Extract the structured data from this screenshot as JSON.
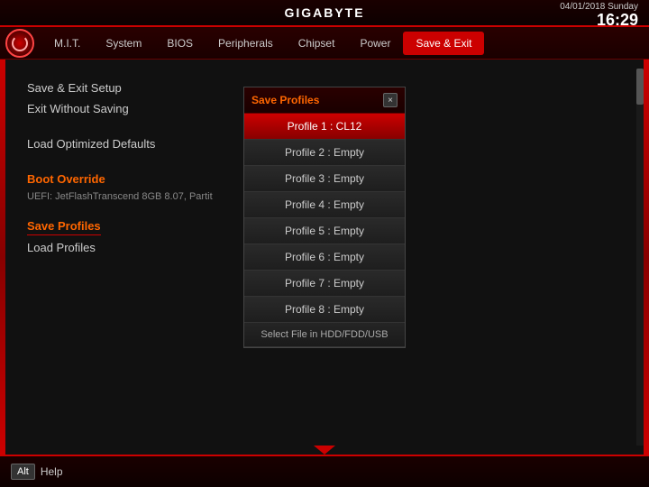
{
  "header": {
    "title": "GIGABYTE",
    "date": "04/01/2018",
    "day": "Sunday",
    "time": "16:29"
  },
  "navbar": {
    "items": [
      {
        "label": "M.I.T.",
        "active": false
      },
      {
        "label": "System",
        "active": false
      },
      {
        "label": "BIOS",
        "active": false
      },
      {
        "label": "Peripherals",
        "active": false
      },
      {
        "label": "Chipset",
        "active": false
      },
      {
        "label": "Power",
        "active": false
      },
      {
        "label": "Save & Exit",
        "active": true
      }
    ]
  },
  "content": {
    "items": [
      {
        "label": "Save & Exit Setup"
      },
      {
        "label": "Exit Without Saving"
      }
    ],
    "defaults": "Load Optimized Defaults",
    "boot_override_title": "Boot Override",
    "boot_override_value": "UEFI: JetFlashTranscend 8GB 8.07, Partit",
    "save_profiles_label": "Save Profiles",
    "load_profiles_label": "Load Profiles"
  },
  "popup": {
    "title": "Save Profiles",
    "close_label": "×",
    "profiles": [
      {
        "label": "Profile 1 : CL12",
        "active": true
      },
      {
        "label": "Profile 2 : Empty",
        "active": false
      },
      {
        "label": "Profile 3 : Empty",
        "active": false
      },
      {
        "label": "Profile 4 : Empty",
        "active": false
      },
      {
        "label": "Profile 5 : Empty",
        "active": false
      },
      {
        "label": "Profile 6 : Empty",
        "active": false
      },
      {
        "label": "Profile 7 : Empty",
        "active": false
      },
      {
        "label": "Profile 8 : Empty",
        "active": false
      }
    ],
    "select_file_label": "Select File in HDD/FDD/USB"
  },
  "bottombar": {
    "alt_label": "Alt",
    "help_label": "Help"
  }
}
